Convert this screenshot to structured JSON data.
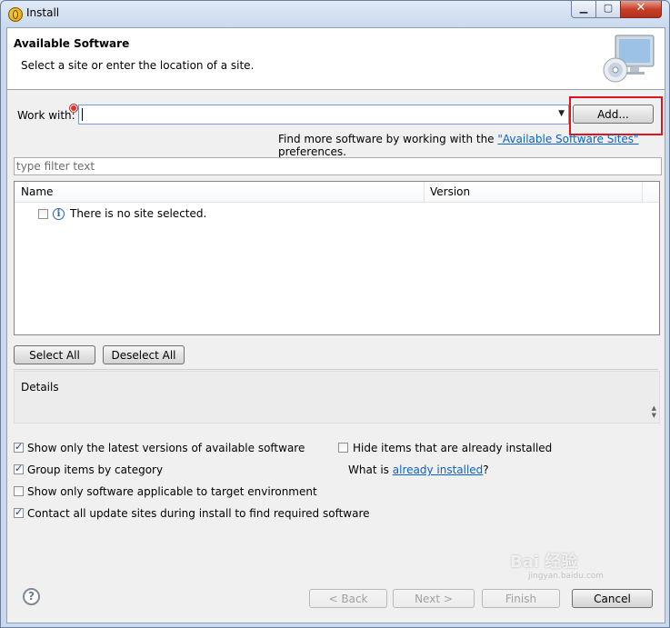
{
  "window": {
    "title": "Install"
  },
  "banner": {
    "title": "Available Software",
    "subtitle": "Select a site or enter the location of a site."
  },
  "work_with": {
    "label": "Work with:",
    "value": "",
    "add_button": "Add..."
  },
  "find_more": {
    "prefix": "Find more software by working with the ",
    "link": "\"Available Software Sites\"",
    "suffix": " preferences."
  },
  "filter": {
    "placeholder": "type filter text"
  },
  "tree": {
    "columns": [
      "Name",
      "Version"
    ],
    "rows": [
      {
        "label": "There is no site selected.",
        "checked": false
      }
    ]
  },
  "buttons": {
    "select_all": "Select All",
    "deselect_all": "Deselect All",
    "back": "< Back",
    "next": "Next >",
    "finish": "Finish",
    "cancel": "Cancel"
  },
  "details": {
    "label": "Details"
  },
  "options": {
    "show_latest": {
      "label": "Show only the latest versions of available software",
      "checked": true
    },
    "group_by_category": {
      "label": "Group items by category",
      "checked": true
    },
    "show_applicable": {
      "label": "Show only software applicable to target environment",
      "checked": false
    },
    "contact_sites": {
      "label": "Contact all update sites during install to find required software",
      "checked": true
    },
    "hide_installed": {
      "label": "Hide items that are already installed",
      "checked": false
    },
    "what_is_prefix": "What is ",
    "what_is_link": "already installed",
    "what_is_suffix": "?"
  },
  "watermark": {
    "text": "Bai 经验",
    "sub": "jingyan.baidu.com"
  },
  "colors": {
    "highlight": "#e0141e",
    "link": "#0a63c8"
  }
}
